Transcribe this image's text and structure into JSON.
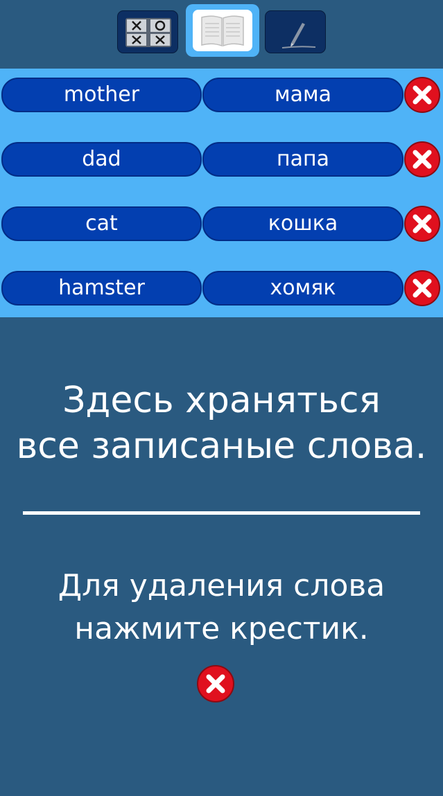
{
  "nav": {
    "tabs": [
      {
        "id": "games",
        "icon": "tic-tac-toe-icon",
        "active": false
      },
      {
        "id": "dictionary",
        "icon": "open-book-icon",
        "active": true
      },
      {
        "id": "write",
        "icon": "pencil-icon",
        "active": false
      }
    ]
  },
  "words": [
    {
      "en": "mother",
      "ru": "мама"
    },
    {
      "en": "dad",
      "ru": "папа"
    },
    {
      "en": "cat",
      "ru": "кошка"
    },
    {
      "en": "hamster",
      "ru": "хомяк"
    }
  ],
  "info": {
    "title_line1": "Здесь храняться",
    "title_line2": "все записаные слова.",
    "hint_line1": "Для удаления слова",
    "hint_line2": "нажмите крестик."
  },
  "colors": {
    "background": "#2a5a80",
    "list_background": "#4fb3f7",
    "pill": "#033fb0",
    "delete": "#e0101e"
  }
}
